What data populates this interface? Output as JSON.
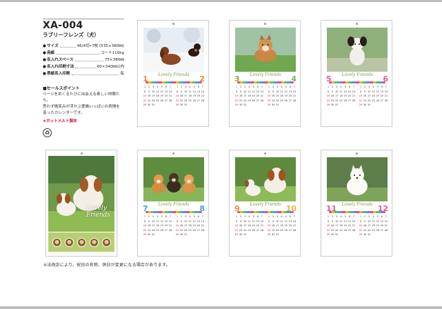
{
  "product": {
    "code": "XA-004",
    "name": "ラブリーフレンズ（犬）"
  },
  "specs": [
    {
      "label": "サイズ",
      "value": "46/4切•7枚 (535×380㎜)"
    },
    {
      "label": "用紙",
      "value": "コート110kg"
    },
    {
      "label": "名入れスペース",
      "value": "75×380㎜"
    },
    {
      "label": "名入れ印刷寸法",
      "value": "60×340㎜以内"
    },
    {
      "label": "表紙名入印刷",
      "value": "有"
    }
  ],
  "sales": {
    "heading": "■セールスポイント",
    "lines": [
      "ページをめくるたびに出会える楽しい仲間たち。",
      "思わず微笑みが浮かぶ愛嬌いっぱいの表情を",
      "追ったカレンダーです。"
    ],
    "hotmelt": "★ホットメルト製本"
  },
  "eco_icon": "eco-mark-icon",
  "cover": {
    "title_line1": "Lovely",
    "title_line2": "Friends"
  },
  "pages": [
    {
      "left": "1",
      "right": "2",
      "left_color": "#e58a3a",
      "right_color": "#e58a3a",
      "photo": "dachshunds-in-snow"
    },
    {
      "left": "3",
      "right": "4",
      "left_color": "#7cb342",
      "right_color": "#7cb342",
      "photo": "shiba-puppy"
    },
    {
      "left": "5",
      "right": "6",
      "left_color": "#e75a8c",
      "right_color": "#e75a8c",
      "photo": "papillon"
    },
    {
      "left": "7",
      "right": "8",
      "left_color": "#3fa6dd",
      "right_color": "#3fa6dd",
      "photo": "corgi-puppies"
    },
    {
      "left": "9",
      "right": "10",
      "left_color": "#e58a3a",
      "right_color": "#f0b22d",
      "photo": "cavalier-dogs"
    },
    {
      "left": "11",
      "right": "12",
      "left_color": "#e75a8c",
      "right_color": "#e75a8c",
      "photo": "pomeranian"
    }
  ],
  "logo_text": "Lovely Friends",
  "footnote": "※法改正により、祝日の名称、休日が変更になる場合があります。"
}
